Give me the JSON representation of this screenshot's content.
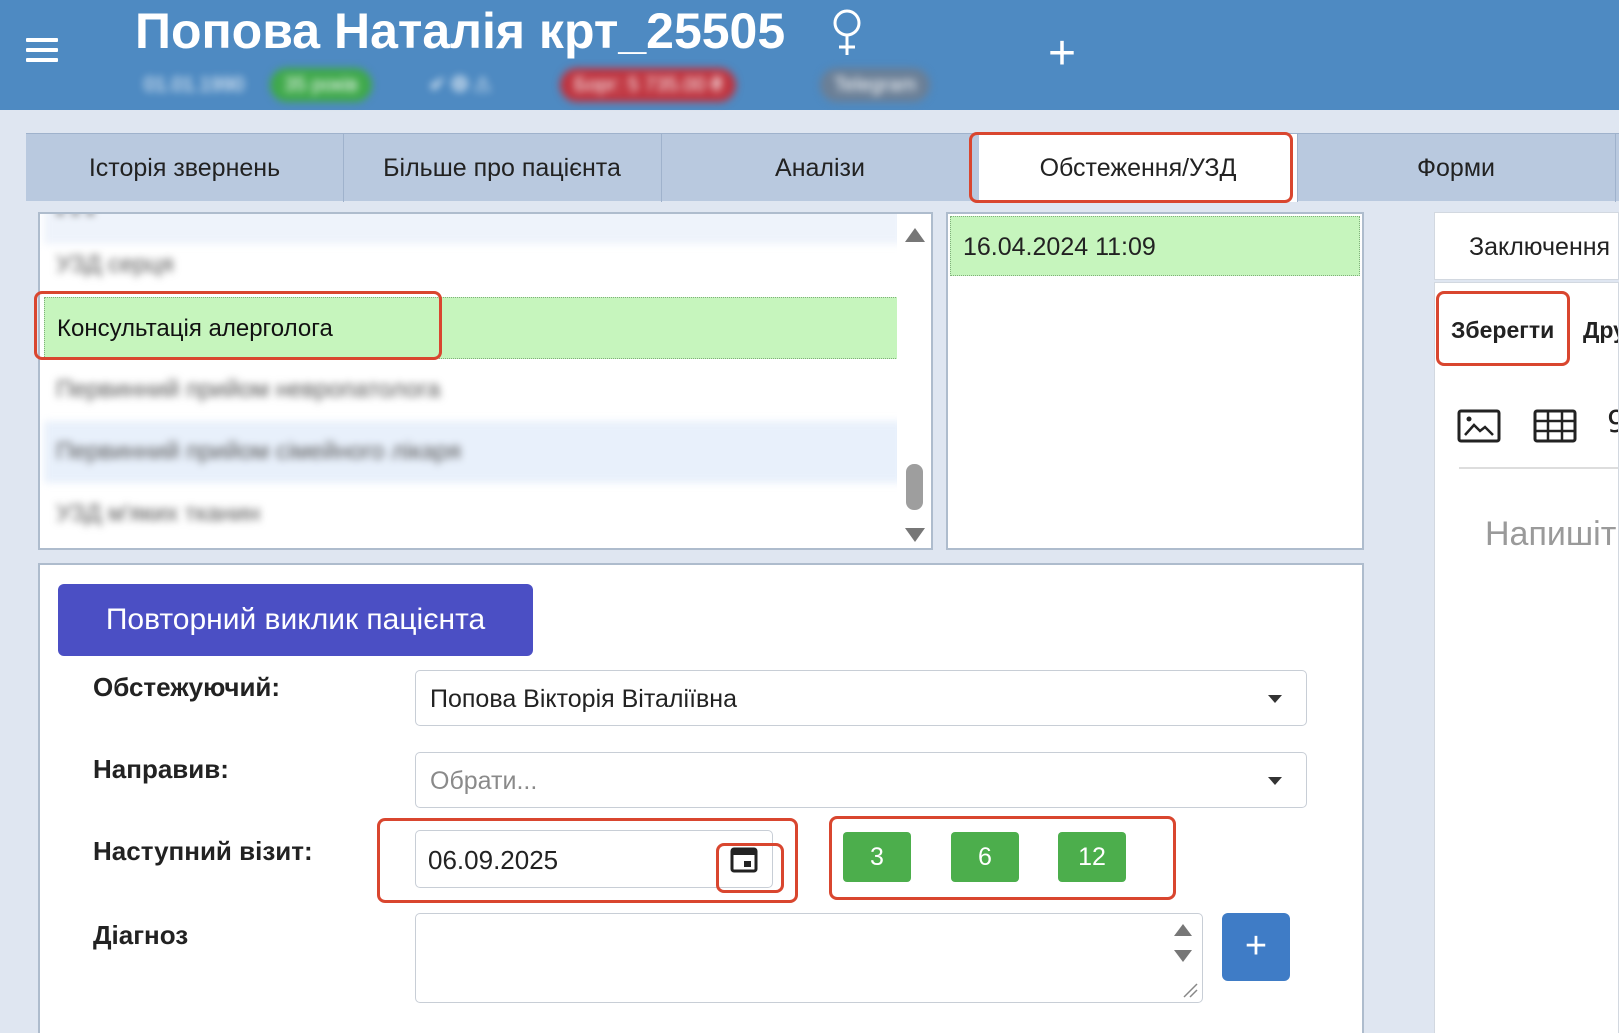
{
  "header": {
    "patient_name": "Попова Наталія крт_25505",
    "add_label": "+",
    "info_chips": [
      "01.01.1990",
      "35 років",
      "✔ ❂ ⚠",
      "Борг: 5 735.00 ₴",
      "Telegram"
    ]
  },
  "tabs": [
    {
      "label": "Історія звернень"
    },
    {
      "label": "Більше про пацієнта"
    },
    {
      "label": "Аналізи"
    },
    {
      "label": "Обстеження/УЗД",
      "active": true
    },
    {
      "label": "Форми"
    }
  ],
  "exam_list": {
    "items": [
      {
        "label": "УЗД серця",
        "blurred": true
      },
      {
        "label": "Консультація алерголога",
        "selected": true
      },
      {
        "label": "Первинний прийом невропатолога",
        "blurred": true
      },
      {
        "label": "Первинний прийом сімейного лікаря",
        "blurred": true
      },
      {
        "label": "УЗД м'яких тканин",
        "blurred": true
      }
    ]
  },
  "dates": {
    "items": [
      "16.04.2024 11:09"
    ]
  },
  "form": {
    "recall_button": "Повторний виклик пацієнта",
    "examiner_label": "Обстежуючий:",
    "examiner_value": "Попова Вікторія Віталіївна",
    "referrer_label": "Направив:",
    "referrer_placeholder": "Обрати...",
    "next_visit_label": "Наступний візит:",
    "next_visit_value": "06.09.2025",
    "quick_buttons": [
      "3",
      "6",
      "12"
    ],
    "diagnosis_label": "Діагноз",
    "add_diagnosis": "+"
  },
  "right_panel": {
    "conclusion_tab": "Заключення",
    "save_label": "Зберегти",
    "other_label": "Дру",
    "editor_placeholder": "Напишіт",
    "more_label": "9"
  },
  "colors": {
    "header_bg": "#4e8ac2",
    "highlight_red": "#d9462f",
    "selected_green": "#c6f5bd",
    "recall_button": "#4b4fc4",
    "quick_green": "#4cae4c",
    "add_blue": "#3f7cc6"
  }
}
